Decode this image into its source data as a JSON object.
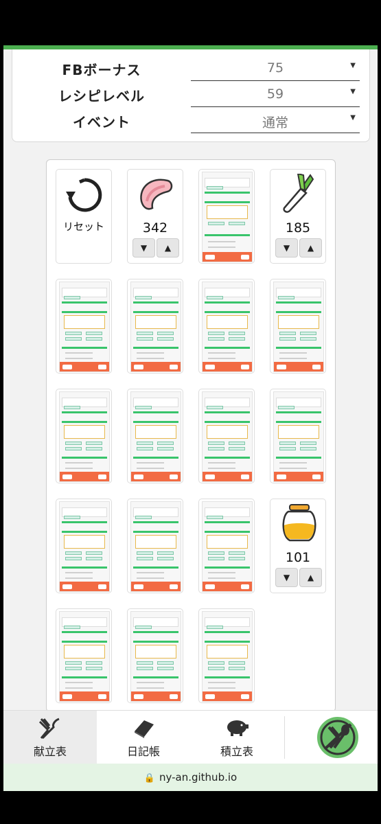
{
  "settings": {
    "fb_bonus": {
      "label": "FBボーナス",
      "value": "75"
    },
    "recipe_level": {
      "label": "レシピレベル",
      "value": "59"
    },
    "event": {
      "label": "イベント",
      "value": "通常"
    }
  },
  "tiles": {
    "reset": {
      "label": "リセット"
    },
    "meat": {
      "count": "342"
    },
    "leek": {
      "count": "185"
    },
    "honey": {
      "count": "101"
    },
    "stepper": {
      "down": "▼",
      "up": "▲"
    }
  },
  "tabs": [
    {
      "label": "献立表",
      "icon": "fork-knife-icon"
    },
    {
      "label": "日記帳",
      "icon": "book-icon"
    },
    {
      "label": "積立表",
      "icon": "piggy-bank-icon"
    }
  ],
  "browser": {
    "url": "ny-an.github.io"
  },
  "colors": {
    "accent": "#4caf50",
    "footer": "#f26b43",
    "tab_active": "#ececec"
  }
}
